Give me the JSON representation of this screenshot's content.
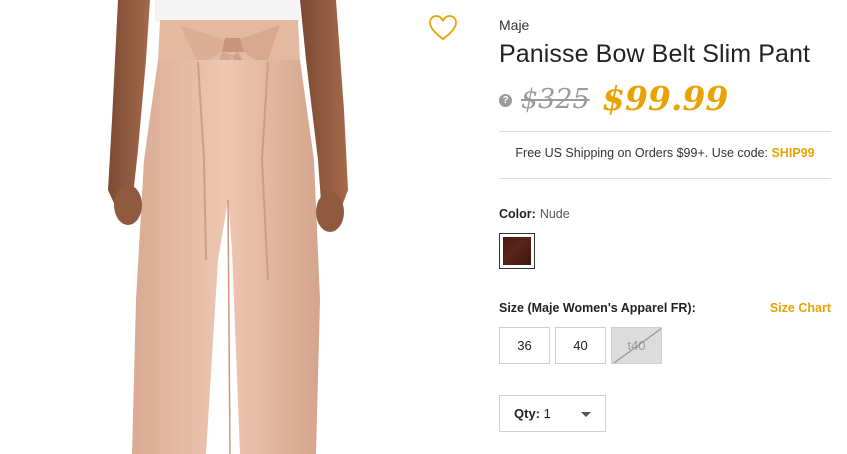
{
  "product": {
    "brand": "Maje",
    "title": "Panisse Bow Belt Slim Pant",
    "original_price": "$325",
    "sale_price": "$99.99",
    "price_help": "?"
  },
  "shipping": {
    "text": "Free US Shipping on Orders $99+. Use code: ",
    "code": "SHIP99"
  },
  "color": {
    "label": "Color:",
    "value": "Nude",
    "swatch_color": "#4a1a12"
  },
  "size": {
    "label": "Size (Maje Women's Apparel FR):",
    "chart_link": "Size Chart",
    "options": [
      {
        "label": "36",
        "available": true
      },
      {
        "label": "40",
        "available": true
      },
      {
        "label": "t40",
        "available": false
      }
    ]
  },
  "quantity": {
    "label": "Qty:",
    "value": "1"
  },
  "colors": {
    "accent": "#e8a300",
    "muted": "#9b9b9b"
  },
  "icons": {
    "wishlist": "heart-icon",
    "help": "help-icon",
    "dropdown": "chevron-down-icon"
  }
}
